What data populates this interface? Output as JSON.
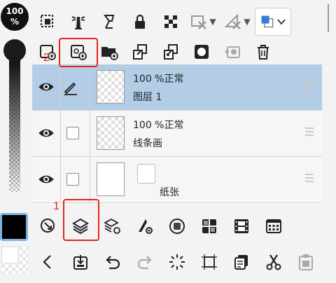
{
  "opacity": {
    "value": "100",
    "unit": "%"
  },
  "color_mode": {
    "accent": "#2f7ed8"
  },
  "layers": [
    {
      "blend": "100 %正常",
      "name": "图层 1",
      "selected": true,
      "type": "raster",
      "visible": true,
      "editing": true
    },
    {
      "blend": "100 %正常",
      "name": "线条画",
      "selected": false,
      "type": "raster",
      "visible": true,
      "editing": false
    },
    {
      "name": "纸张",
      "selected": false,
      "type": "paper",
      "visible": true,
      "editing": false
    }
  ],
  "annotations": {
    "label_1": "1",
    "label_2": "2"
  },
  "colors": {
    "selected_row": "#b3cde6",
    "annotation": "#e8251c",
    "primary_color": "#000000"
  }
}
